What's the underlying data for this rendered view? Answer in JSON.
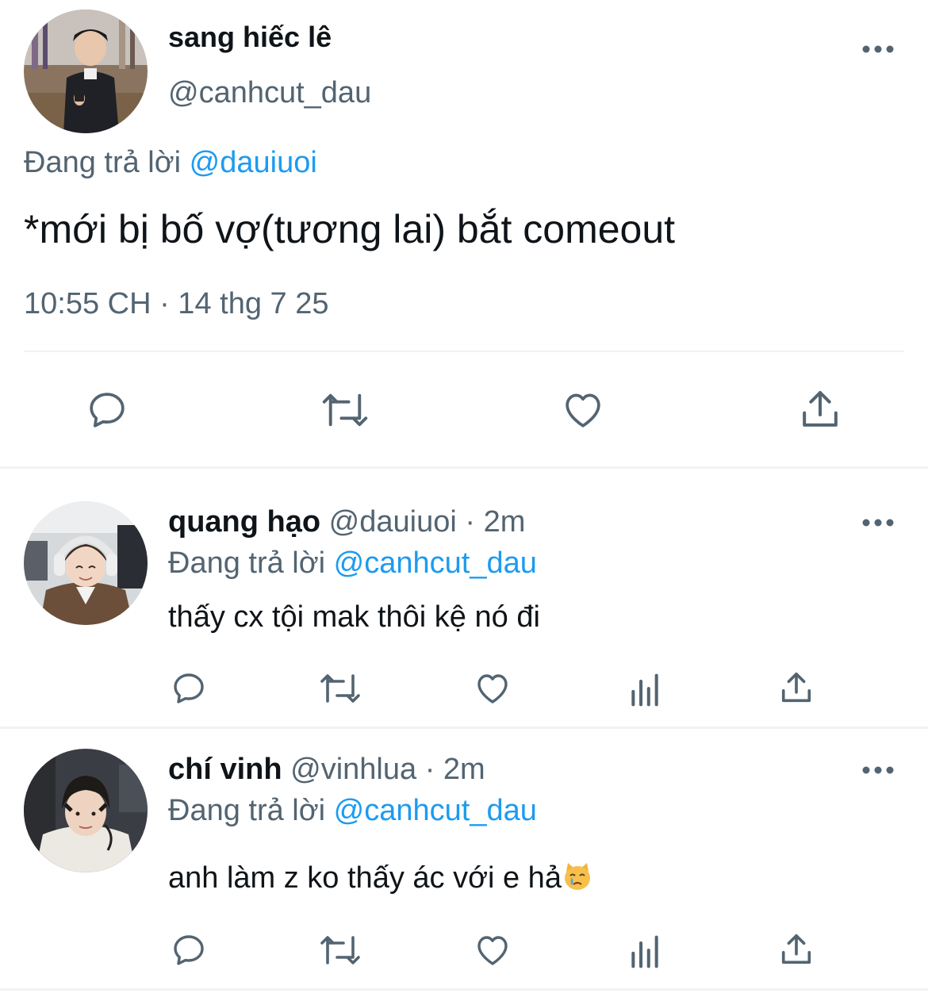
{
  "main_tweet": {
    "display_name": "sang hiếc lê",
    "handle": "@canhcut_dau",
    "reply_prefix": "Đang trả lời",
    "reply_to": "@dauiuoi",
    "text": "*mới bị bố vợ(tương lai) bắt comeout",
    "timestamp": "10:55 CH · 14 thg 7 25",
    "actions": [
      "reply-icon",
      "retweet-icon",
      "like-icon",
      "share-icon"
    ]
  },
  "replies": [
    {
      "display_name": "quang hạo",
      "handle": "@dauiuoi",
      "time": "· 2m",
      "reply_prefix": "Đang trả lời",
      "reply_to": "@canhcut_dau",
      "text": "thấy cx tội mak thôi kệ nó đi",
      "actions": [
        "reply-icon",
        "retweet-icon",
        "like-icon",
        "views-icon",
        "share-icon"
      ]
    },
    {
      "display_name": "chí vinh",
      "handle": "@vinhlua",
      "time": "· 2m",
      "reply_prefix": "Đang trả lời",
      "reply_to": "@canhcut_dau",
      "text": "anh làm z ko thấy ác với e hả",
      "emoji": "crying-cat-emoji",
      "actions": [
        "reply-icon",
        "retweet-icon",
        "like-icon",
        "views-icon",
        "share-icon"
      ]
    }
  ],
  "colors": {
    "text": "#0f1419",
    "secondary": "#536471",
    "link": "#1d9bf0",
    "divider": "#eff3f4"
  }
}
